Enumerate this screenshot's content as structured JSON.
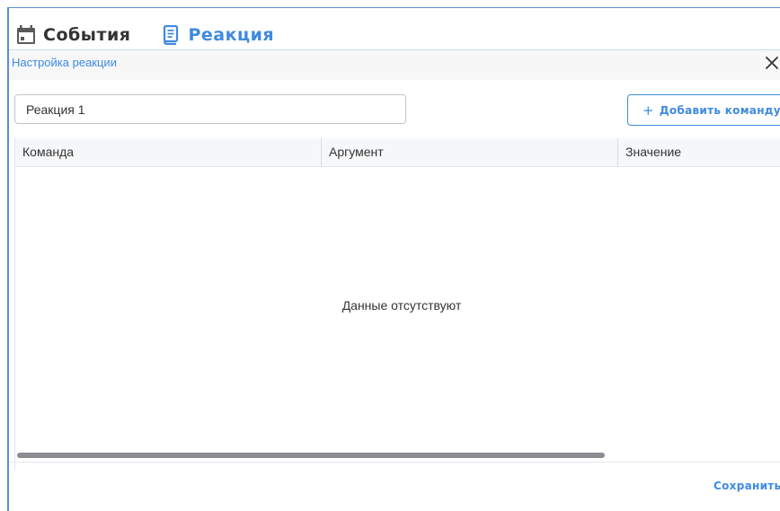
{
  "tabs": {
    "events": {
      "label": "События",
      "icon": "calendar-icon"
    },
    "reaction": {
      "label": "Реакция",
      "icon": "document-list-icon"
    }
  },
  "dialog": {
    "title": "Настройка реакции",
    "close_icon": "close-icon",
    "name_value": "Реакция 1",
    "add_command_label": "Добавить команду",
    "add_command_prefix": "+",
    "save_label": "Сохранить"
  },
  "table": {
    "columns": [
      "Команда",
      "Аргумент",
      "Значение"
    ],
    "rows": [],
    "empty_text": "Данные отсутствуют",
    "horizontal_scroll_visible_fraction": 0.76
  },
  "colors": {
    "accent": "#3f8ae0",
    "frame_border": "#5b8fd6",
    "header_bg": "#f7f7f8",
    "scrollbar": "#8a8c90"
  }
}
